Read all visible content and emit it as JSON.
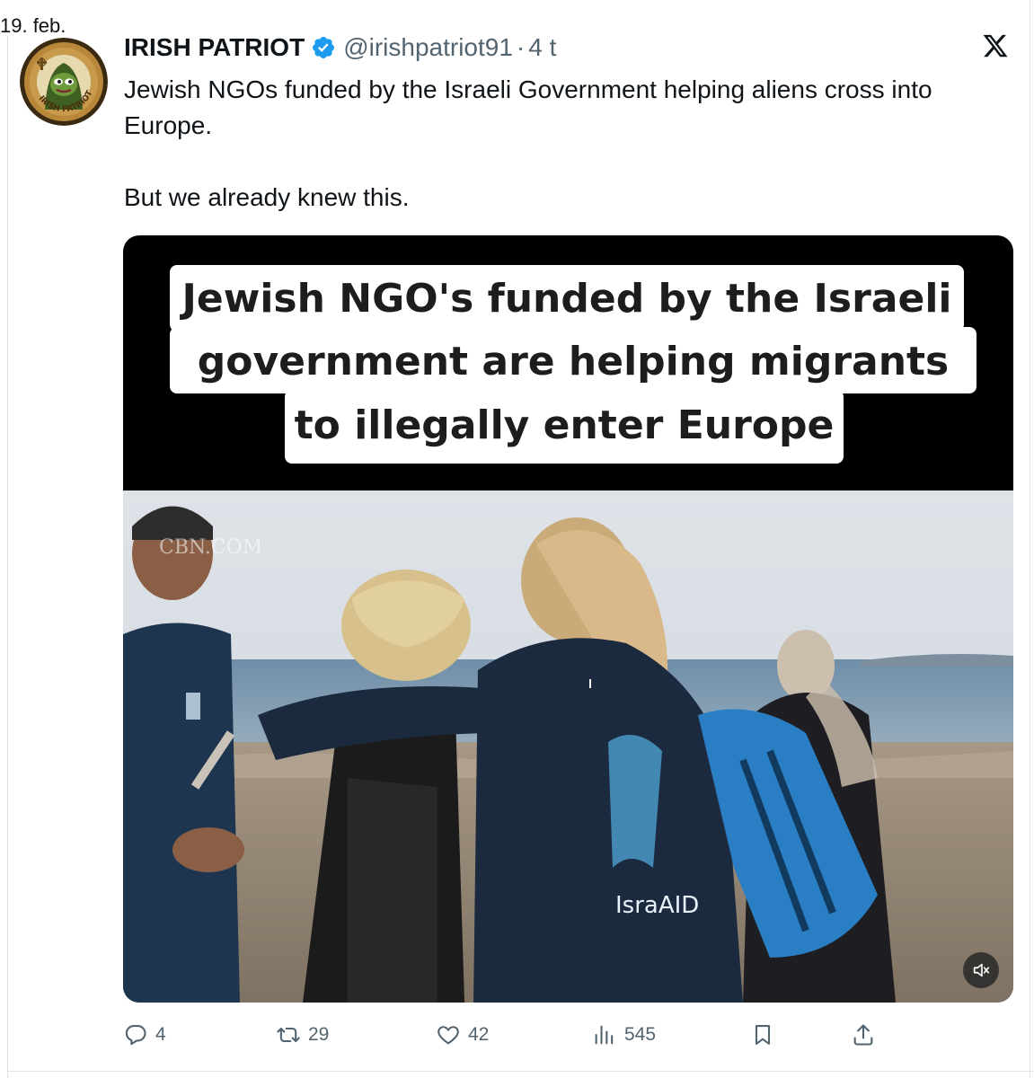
{
  "date_label": "19. feb.",
  "tweet": {
    "author_name": "IRISH PATRIOT",
    "handle": "@irishpatriot91",
    "separator": "·",
    "time": "4 t",
    "text_line_1": "Jewish NGOs funded by the Israeli Government helping aliens cross into Europe.",
    "text_line_2": "But we already knew this.",
    "avatar_text": "IRISH PATRIOT"
  },
  "media": {
    "caption_lines": [
      "Jewish NGO's funded by the Israeli",
      "government are helping migrants",
      "to illegally enter Europe"
    ],
    "watermark": "CBN.COM",
    "shirt_logo": "IsraAID"
  },
  "actions": {
    "replies": "4",
    "retweets": "29",
    "likes": "42",
    "views": "545"
  },
  "colors": {
    "verified": "#1d9bf0",
    "text_primary": "#0f1419",
    "text_secondary": "#536471"
  }
}
